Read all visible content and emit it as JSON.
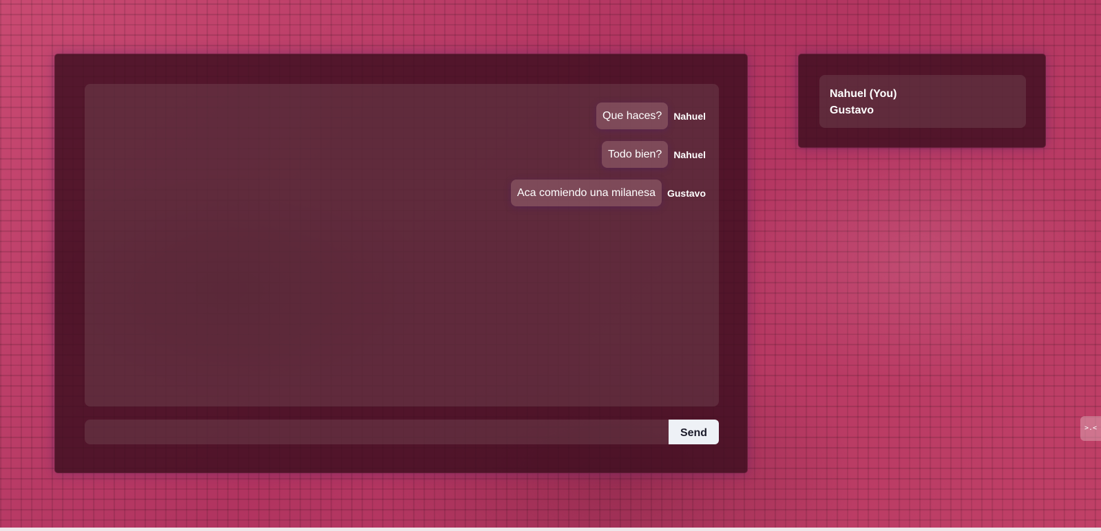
{
  "chat": {
    "messages": [
      {
        "text": "Que haces?",
        "author": "Nahuel"
      },
      {
        "text": "Todo bien?",
        "author": "Nahuel"
      },
      {
        "text": "Aca comiendo una milanesa",
        "author": "Gustavo"
      }
    ],
    "input": {
      "value": "",
      "placeholder": ""
    },
    "send_label": "Send"
  },
  "users": {
    "items": [
      {
        "label": "Nahuel (You)"
      },
      {
        "label": "Gustavo"
      }
    ]
  },
  "side_widget": {
    "label": ">.<"
  },
  "colors": {
    "background": "#b8385f",
    "panel": "#3c0e1e",
    "send_button": "#eef1f6"
  }
}
